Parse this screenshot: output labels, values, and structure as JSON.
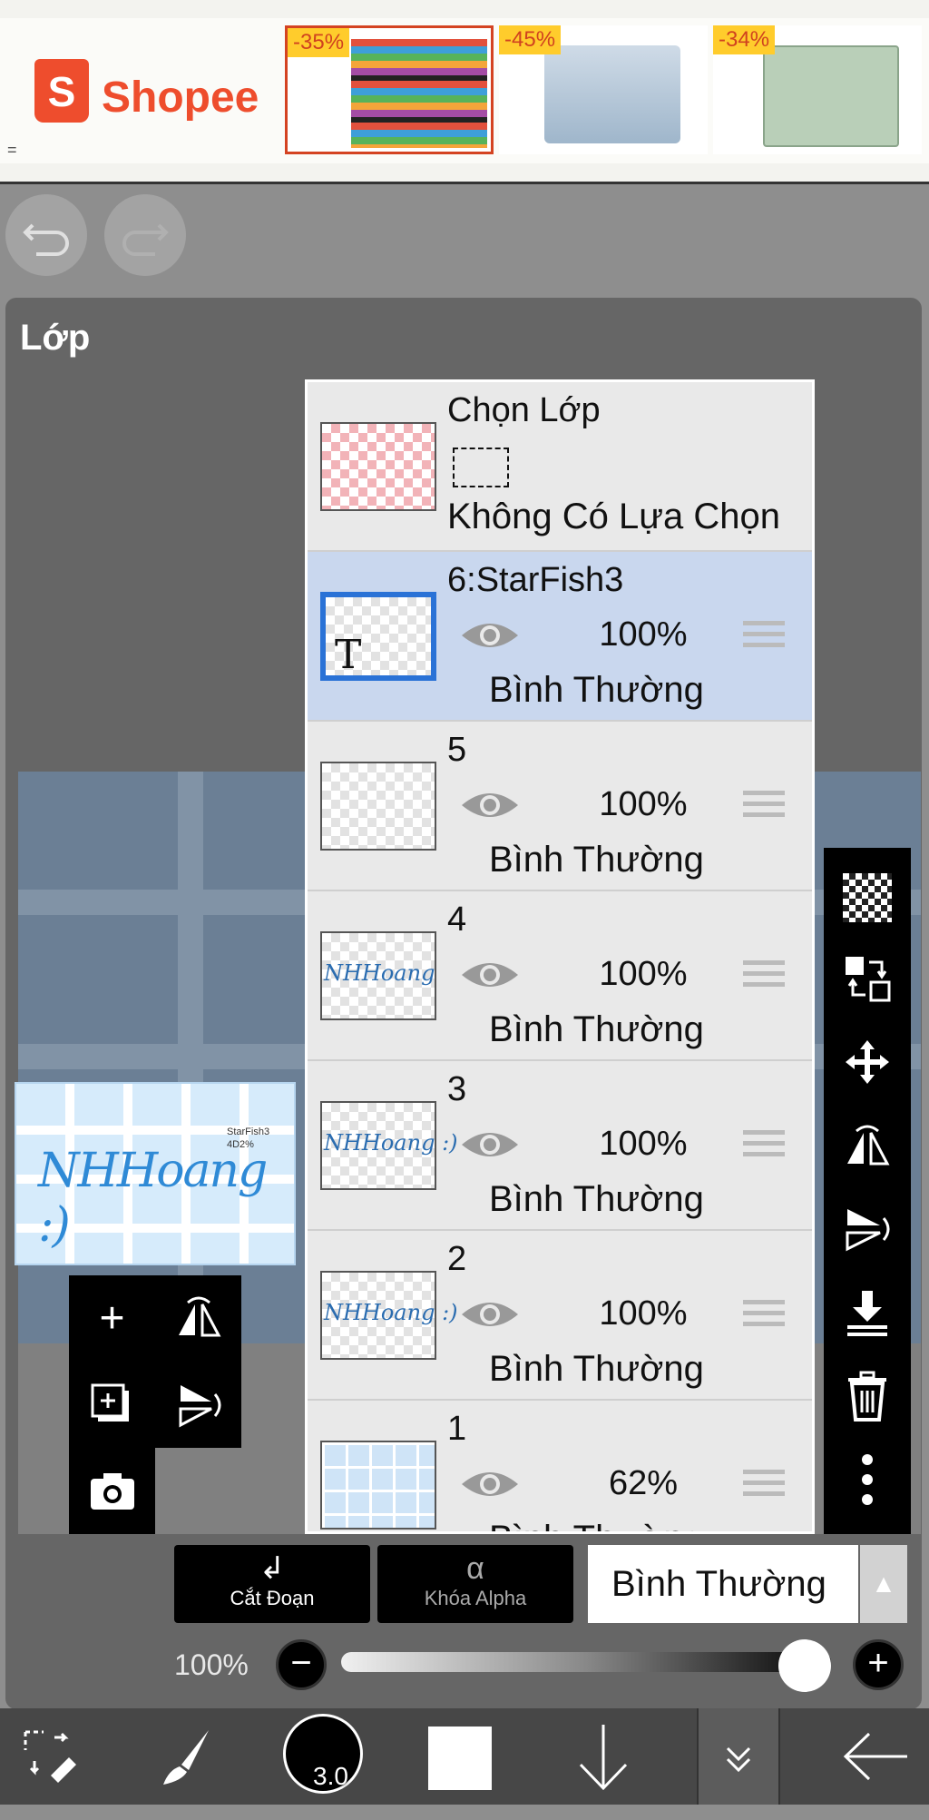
{
  "ad": {
    "brand": "Shopee",
    "menu_glyph": "=",
    "cards": [
      {
        "discount": "-35%"
      },
      {
        "discount": "-45%"
      },
      {
        "discount": "-34%"
      }
    ]
  },
  "panel": {
    "title": "Lớp"
  },
  "preview": {
    "text": "NHHoang :)",
    "small": "StarFish3\n4D2%"
  },
  "selection_row": {
    "title": "Chọn Lớp",
    "subtitle": "Không Có Lựa Chọn"
  },
  "layers": [
    {
      "name": "6:StarFish3",
      "opacity": "100%",
      "blend": "Bình Thường",
      "active": true,
      "thumb": "text"
    },
    {
      "name": "5",
      "opacity": "100%",
      "blend": "Bình Thường",
      "active": false,
      "thumb": "empty"
    },
    {
      "name": "4",
      "opacity": "100%",
      "blend": "Bình Thường",
      "active": false,
      "thumb": "NHHoang"
    },
    {
      "name": "3",
      "opacity": "100%",
      "blend": "Bình Thường",
      "active": false,
      "thumb": "NHHoang :)"
    },
    {
      "name": "2",
      "opacity": "100%",
      "blend": "Bình Thường",
      "active": false,
      "thumb": "NHHoang :)"
    },
    {
      "name": "1",
      "opacity": "62%",
      "blend": "Bình Thường",
      "active": false,
      "thumb": "grid"
    }
  ],
  "thumb_T": "T",
  "actions": {
    "clip_label": "Cắt Đoạn",
    "alpha_label": "Khóa Alpha",
    "alpha_icon": "α",
    "blend_mode": "Bình Thường"
  },
  "opacity_slider": {
    "label": "100%",
    "value": 1.0
  },
  "brush": {
    "size": "3.0"
  },
  "colors": {
    "accent": "#2a72d6",
    "shopee": "#ee4d2d",
    "active_row": "#c9d7ee"
  }
}
